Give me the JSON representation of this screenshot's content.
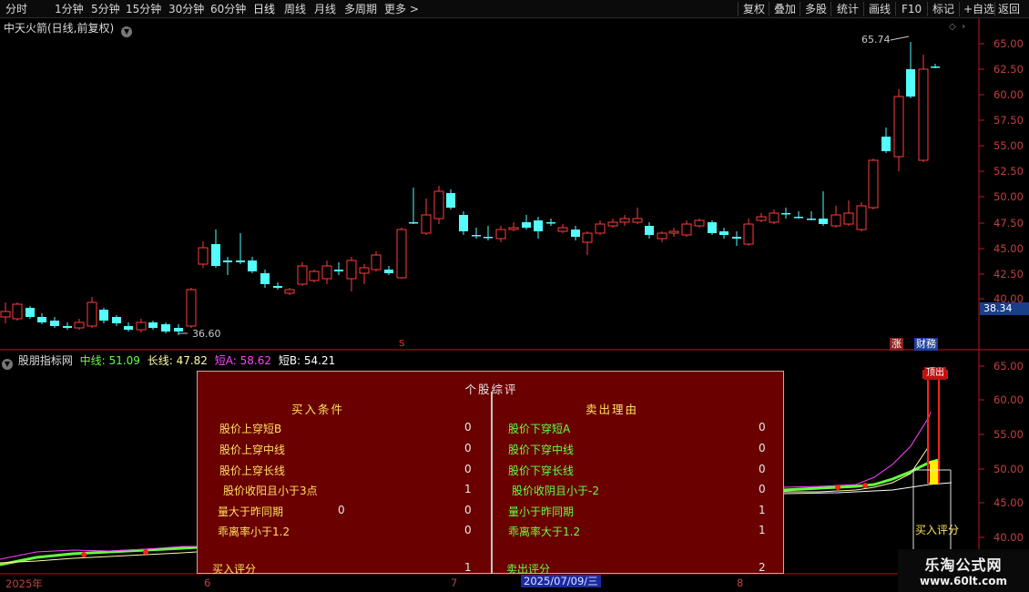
{
  "toolbar": {
    "left": [
      "分时",
      "1分钟",
      "5分钟",
      "15分钟",
      "30分钟",
      "60分钟",
      "日线",
      "周线",
      "月线",
      "多周期",
      "更多 >"
    ],
    "right": [
      "复权",
      "叠加",
      "多股",
      "统计",
      "画线",
      "F10",
      "标记",
      "+自选",
      "返回"
    ]
  },
  "chart": {
    "title": "中天火箭(日线,前复权)",
    "high_label": "65.74",
    "low_label": "36.60",
    "current_price": "38.34",
    "s_marker": "S",
    "tag_zhang": "涨",
    "tag_caiwu": "财務",
    "y_labels": [
      "65.00",
      "62.50",
      "60.00",
      "57.50",
      "55.00",
      "52.50",
      "50.00",
      "47.50",
      "45.00",
      "42.50",
      "40.00"
    ],
    "up_color": "#ff3c3c",
    "down_color": "#54fcfc"
  },
  "indicator": {
    "name": "股朋指标网",
    "zx_label": "中线: 51.09",
    "cx_label": "长线: 47.82",
    "da_label": "短A: 58.62",
    "db_label": "短B: 54.21",
    "y_labels": [
      "65.00",
      "60.00",
      "55.00",
      "50.00",
      "45.00",
      "40.00"
    ],
    "top_tag": "顶出",
    "buy_score_label": "买入评分"
  },
  "panel": {
    "title": "个股综评",
    "buy_title": "买入条件",
    "sell_title": "卖出理由",
    "buy_rows": [
      {
        "label": "股价上穿短B",
        "value": "0"
      },
      {
        "label": "股价上穿中线",
        "value": "0"
      },
      {
        "label": "股价上穿长线",
        "value": "0"
      },
      {
        "label": "股价收阳且小于3点",
        "value": "1"
      },
      {
        "label": "量大于昨同期",
        "extra": "0",
        "value": "0"
      },
      {
        "label": "乖离率小于1.2",
        "value": "0"
      }
    ],
    "sell_rows": [
      {
        "label": "股价下穿短A",
        "value": "0"
      },
      {
        "label": "股价下穿中线",
        "value": "0"
      },
      {
        "label": "股价下穿长线",
        "value": "0"
      },
      {
        "label": "股价收阴且小于-2",
        "value": "0"
      },
      {
        "label": "量小于昨同期",
        "value": "1"
      },
      {
        "label": "乖离率大于1.2",
        "value": "1"
      }
    ],
    "buy_score": {
      "label": "买入评分",
      "value": "1"
    },
    "sell_score": {
      "label": "卖出评分",
      "value": "2"
    }
  },
  "datebar": {
    "year": "2025年",
    "m6": "6",
    "m7": "7",
    "m8": "8",
    "cursor": "2025/07/09/三"
  },
  "watermark": {
    "line1": "乐淘公式网",
    "line2": "www.60lt.com"
  }
}
